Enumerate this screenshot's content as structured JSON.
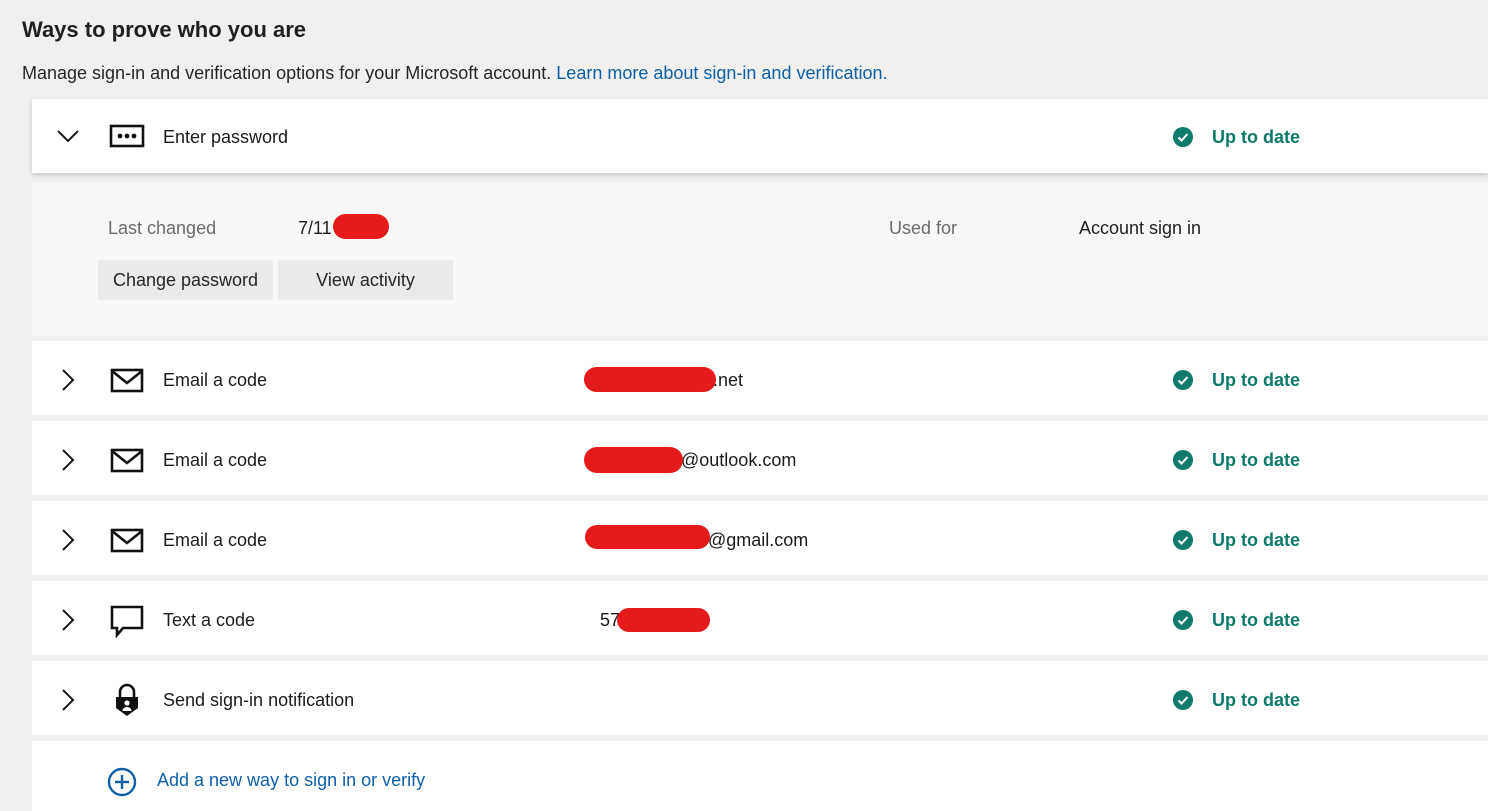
{
  "header": {
    "title": "Ways to prove who you are",
    "subtitle": "Manage sign-in and verification options for your Microsoft account.",
    "learn_more": "Learn more about sign-in and verification."
  },
  "colors": {
    "status_green": "#0e7a6a",
    "link_blue": "#0f5fa8",
    "redaction_red": "#e51b1b"
  },
  "password": {
    "label": "Enter password",
    "icon": "password-dots-icon",
    "status": "Up to date",
    "last_changed_label": "Last changed",
    "last_changed_value": "7/11",
    "used_for_label": "Used for",
    "used_for_value": "Account sign in",
    "change_button": "Change password",
    "activity_button": "View activity"
  },
  "methods": [
    {
      "label": "Email a code",
      "icon": "envelope-icon",
      "value": ".net",
      "status": "Up to date"
    },
    {
      "label": "Email a code",
      "icon": "envelope-icon",
      "value": "@outlook.com",
      "status": "Up to date"
    },
    {
      "label": "Email a code",
      "icon": "envelope-icon",
      "value": "@gmail.com",
      "status": "Up to date"
    },
    {
      "label": "Text a code",
      "icon": "chat-bubble-icon",
      "value": "57",
      "status": "Up to date"
    },
    {
      "label": "Send sign-in notification",
      "icon": "lock-person-icon",
      "value": "",
      "status": "Up to date"
    }
  ],
  "add_method": {
    "label": "Add a new way to sign in or verify",
    "icon": "plus-circle-icon"
  }
}
